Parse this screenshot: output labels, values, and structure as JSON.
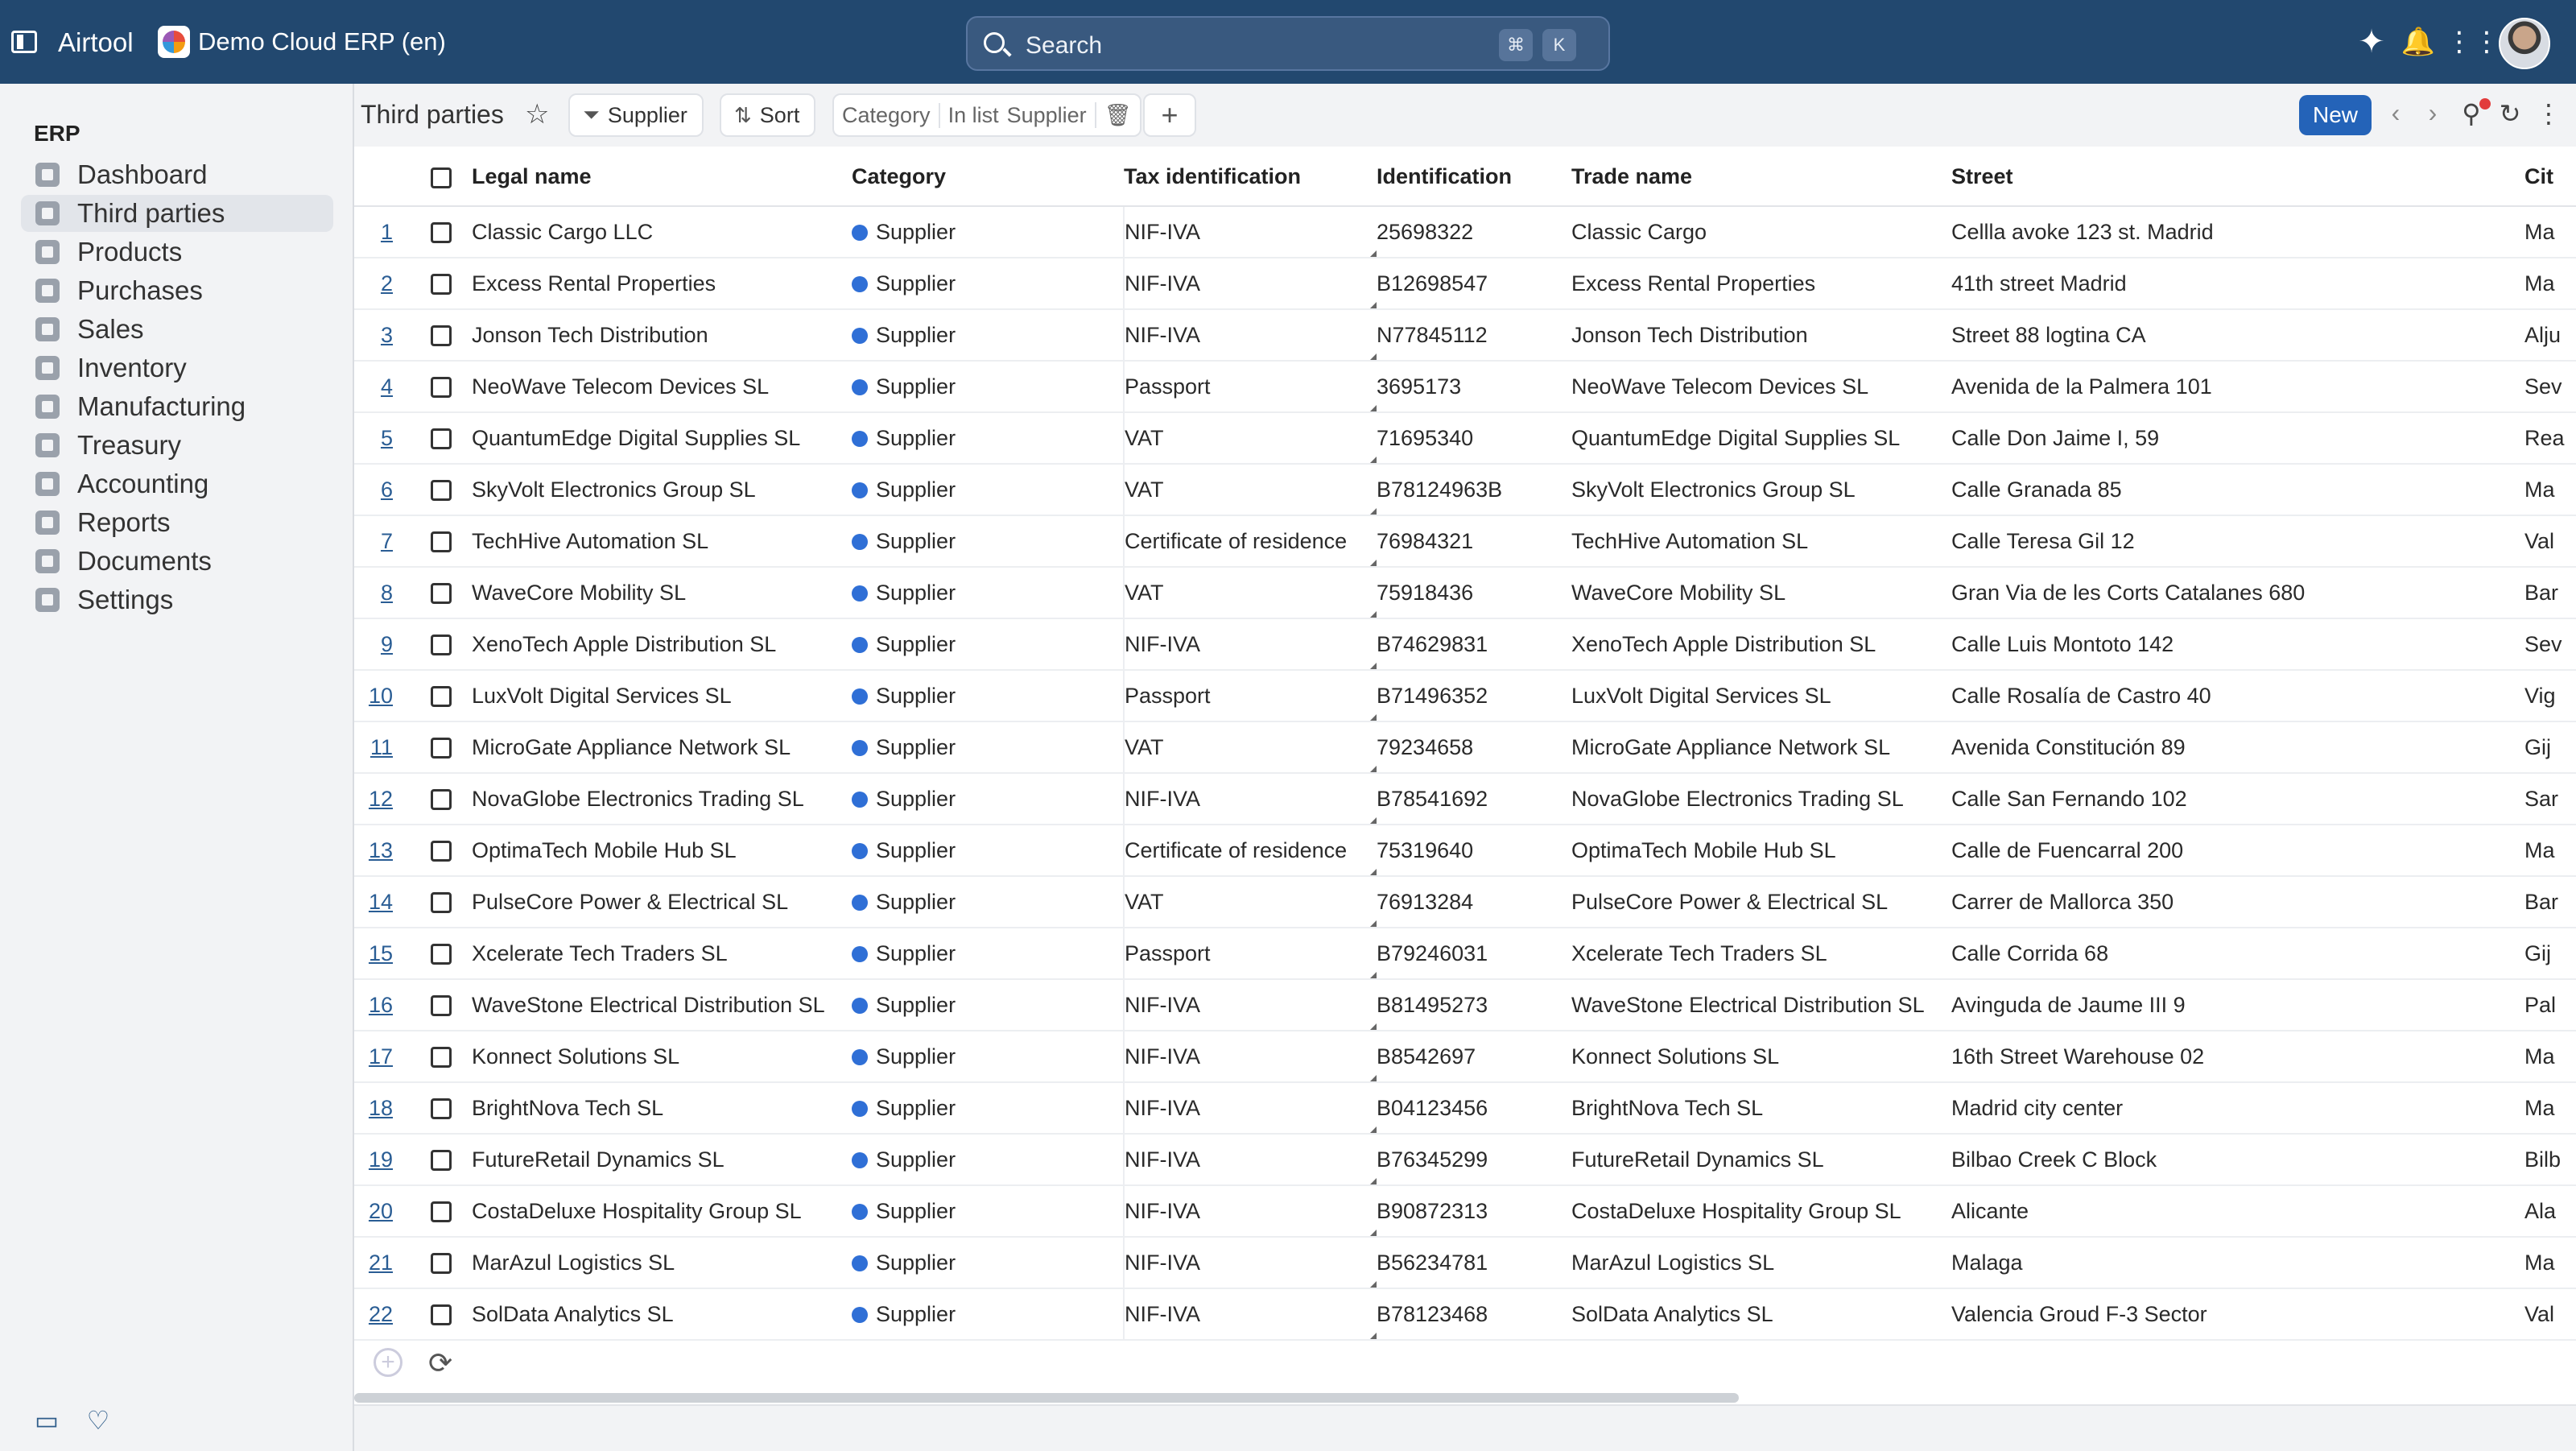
{
  "topbar": {
    "app_name": "Airtool",
    "workspace": "Demo Cloud ERP (en)",
    "search_placeholder": "Search",
    "shortcut_keys": [
      "⌘",
      "K"
    ]
  },
  "sidebar": {
    "section": "ERP",
    "items": [
      {
        "label": "Dashboard"
      },
      {
        "label": "Third parties",
        "active": true
      },
      {
        "label": "Products"
      },
      {
        "label": "Purchases"
      },
      {
        "label": "Sales"
      },
      {
        "label": "Inventory"
      },
      {
        "label": "Manufacturing"
      },
      {
        "label": "Treasury"
      },
      {
        "label": "Accounting"
      },
      {
        "label": "Reports"
      },
      {
        "label": "Documents"
      },
      {
        "label": "Settings"
      }
    ]
  },
  "toolbar": {
    "title": "Third parties",
    "filter_chip": "Supplier",
    "sort_label": "Sort",
    "filter_field": "Category",
    "filter_operator": "In list",
    "filter_value": "Supplier",
    "new_label": "New"
  },
  "table": {
    "columns": [
      "Legal name",
      "Category",
      "Tax identification",
      "Identification",
      "Trade name",
      "Street",
      "Cit"
    ],
    "rows": [
      [
        "1",
        "Classic Cargo LLC",
        "Supplier",
        "NIF-IVA",
        "25698322",
        "Classic Cargo",
        "Cellla avoke 123 st. Madrid",
        "Ma"
      ],
      [
        "2",
        "Excess Rental Properties",
        "Supplier",
        "NIF-IVA",
        "B12698547",
        "Excess Rental Properties",
        "41th street Madrid",
        "Ma"
      ],
      [
        "3",
        "Jonson Tech Distribution",
        "Supplier",
        "NIF-IVA",
        "N77845112",
        "Jonson Tech Distribution",
        "Street 88 logtina CA",
        "Alju"
      ],
      [
        "4",
        "NeoWave Telecom Devices SL",
        "Supplier",
        "Passport",
        "3695173",
        "NeoWave Telecom Devices SL",
        "Avenida de la Palmera 101",
        "Sev"
      ],
      [
        "5",
        "QuantumEdge Digital Supplies SL",
        "Supplier",
        "VAT",
        "71695340",
        "QuantumEdge Digital Supplies SL",
        "Calle Don Jaime I, 59",
        "Rea"
      ],
      [
        "6",
        "SkyVolt Electronics Group SL",
        "Supplier",
        "VAT",
        "B78124963B",
        "SkyVolt Electronics Group SL",
        "Calle Granada 85",
        "Ma"
      ],
      [
        "7",
        "TechHive Automation SL",
        "Supplier",
        "Certificate of residence",
        "76984321",
        "TechHive Automation SL",
        "Calle Teresa Gil 12",
        "Val"
      ],
      [
        "8",
        "WaveCore Mobility SL",
        "Supplier",
        "VAT",
        "75918436",
        "WaveCore Mobility SL",
        "Gran Via de les Corts Catalanes 680",
        "Bar"
      ],
      [
        "9",
        "XenoTech Apple Distribution SL",
        "Supplier",
        "NIF-IVA",
        "B74629831",
        "XenoTech Apple Distribution SL",
        "Calle Luis Montoto 142",
        "Sev"
      ],
      [
        "10",
        "LuxVolt Digital Services SL",
        "Supplier",
        "Passport",
        "B71496352",
        "LuxVolt Digital Services SL",
        "Calle Rosalía de Castro 40",
        "Vig"
      ],
      [
        "11",
        "MicroGate Appliance Network SL",
        "Supplier",
        "VAT",
        "79234658",
        "MicroGate Appliance Network SL",
        "Avenida Constitución 89",
        "Gij"
      ],
      [
        "12",
        "NovaGlobe Electronics Trading SL",
        "Supplier",
        "NIF-IVA",
        "B78541692",
        "NovaGlobe Electronics Trading SL",
        "Calle San Fernando 102",
        "Sar"
      ],
      [
        "13",
        "OptimaTech Mobile Hub SL",
        "Supplier",
        "Certificate of residence",
        "75319640",
        "OptimaTech Mobile Hub SL",
        "Calle de Fuencarral 200",
        "Ma"
      ],
      [
        "14",
        "PulseCore Power & Electrical SL",
        "Supplier",
        "VAT",
        "76913284",
        "PulseCore Power & Electrical SL",
        "Carrer de Mallorca 350",
        "Bar"
      ],
      [
        "15",
        "Xcelerate Tech Traders SL",
        "Supplier",
        "Passport",
        "B79246031",
        "Xcelerate Tech Traders SL",
        "Calle Corrida 68",
        "Gij"
      ],
      [
        "16",
        "WaveStone Electrical Distribution SL",
        "Supplier",
        "NIF-IVA",
        "B81495273",
        "WaveStone Electrical Distribution SL",
        "Avinguda de Jaume III 9",
        "Pal"
      ],
      [
        "17",
        "Konnect Solutions SL",
        "Supplier",
        "NIF-IVA",
        "B8542697",
        "Konnect Solutions SL",
        "16th Street Warehouse 02",
        "Ma"
      ],
      [
        "18",
        "BrightNova Tech SL",
        "Supplier",
        "NIF-IVA",
        "B04123456",
        "BrightNova Tech SL",
        "Madrid city center",
        "Ma"
      ],
      [
        "19",
        "FutureRetail Dynamics SL",
        "Supplier",
        "NIF-IVA",
        "B76345299",
        "FutureRetail Dynamics SL",
        "Bilbao Creek C Block",
        "Bilb"
      ],
      [
        "20",
        "CostaDeluxe Hospitality Group SL",
        "Supplier",
        "NIF-IVA",
        "B90872313",
        "CostaDeluxe Hospitality Group SL",
        "Alicante",
        "Ala"
      ],
      [
        "21",
        "MarAzul Logistics SL",
        "Supplier",
        "NIF-IVA",
        "B56234781",
        "MarAzul Logistics SL",
        "Malaga",
        "Ma"
      ],
      [
        "22",
        "SolData Analytics SL",
        "Supplier",
        "NIF-IVA",
        "B78123468",
        "SolData Analytics SL",
        "Valencia Groud F-3 Sector",
        "Val"
      ]
    ]
  },
  "colors": {
    "topbar": "#22486f",
    "accent": "#2463b8",
    "category_dot": "#2f6fd6"
  }
}
